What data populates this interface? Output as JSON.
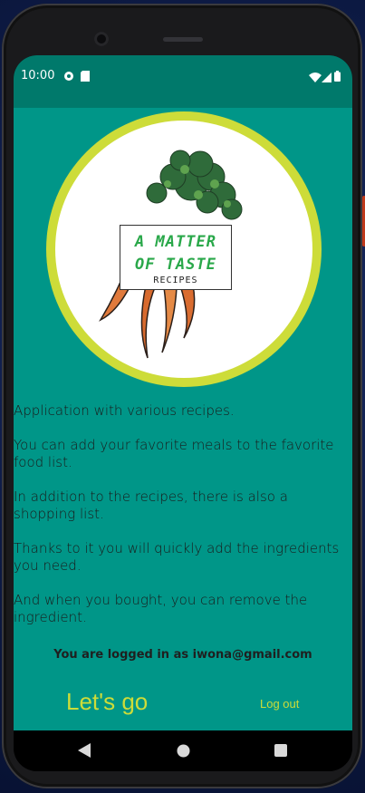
{
  "status_bar": {
    "time": "10:00",
    "icons": [
      "circle-status-icon",
      "sd-card-icon",
      "wifi-icon",
      "signal-icon",
      "battery-icon"
    ]
  },
  "logo": {
    "title": "A MATTER\nOF TASTE",
    "subtitle": "RECIPES"
  },
  "description": [
    "Application with various recipes.",
    "You can add your favorite meals to the favorite food list.",
    "In addition to the recipes, there is also a shopping list.",
    "Thanks to it you will quickly add the ingredients you need.",
    "And when you bought, you can remove the ingredient."
  ],
  "login": {
    "prefix": "You are logged in as ",
    "email": "iwona@gmail.com"
  },
  "actions": {
    "lets_go": "Let's go",
    "log_out": "Log out"
  },
  "nav": [
    "back-icon",
    "home-icon",
    "recents-icon"
  ],
  "colors": {
    "status_bar": "#00796b",
    "background": "#009688",
    "accent": "#cddc39",
    "logo_title": "#2aa84a"
  }
}
